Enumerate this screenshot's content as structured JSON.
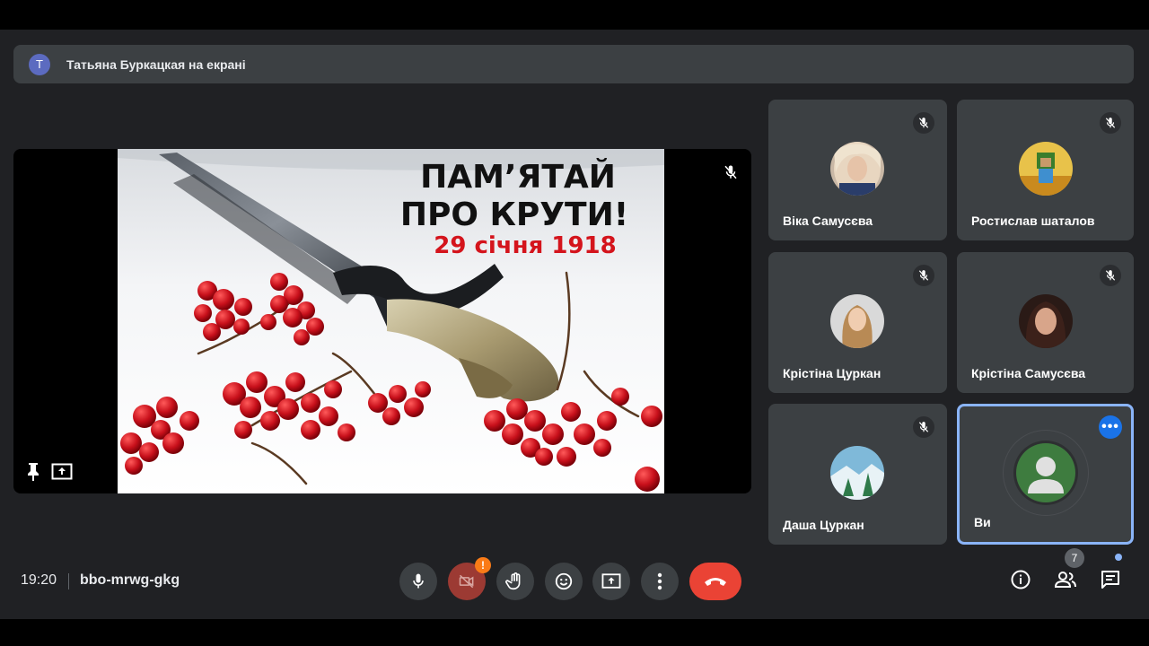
{
  "banner": {
    "avatar_letter": "T",
    "text": "Татьяна Буркацкая на екрані"
  },
  "slide": {
    "line1": "ПАМ’ЯТАЙ",
    "line2": "ПРО КРУТИ!",
    "line3": "29 січня 1918"
  },
  "participants": [
    {
      "name": "Віка Самусєва",
      "muted": true
    },
    {
      "name": "Ростислав шаталов",
      "muted": true
    },
    {
      "name": "Крістіна Цуркан",
      "muted": true
    },
    {
      "name": "Крістіна Самусєва",
      "muted": true
    },
    {
      "name": "Даша Цуркан",
      "muted": true
    },
    {
      "name": "Ви",
      "self": true
    }
  ],
  "bottom": {
    "time": "19:20",
    "meeting_code": "bbo-mrwg-gkg",
    "camera_warning": "!",
    "people_count": "7"
  },
  "colors": {
    "accent": "#1a73e8",
    "hangup": "#ea4335",
    "warning": "#fa7b17",
    "selected_border": "#8ab4f8"
  }
}
